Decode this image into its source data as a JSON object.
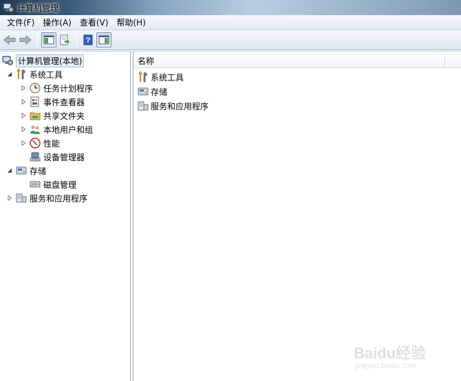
{
  "window": {
    "title": "计算机管理"
  },
  "menubar": {
    "items": [
      {
        "label": "文件(F)"
      },
      {
        "label": "操作(A)"
      },
      {
        "label": "查看(V)"
      },
      {
        "label": "帮助(H)"
      }
    ]
  },
  "toolbar": {
    "buttons": [
      "back-arrow-icon",
      "forward-arrow-icon",
      "show-hide-tree-icon",
      "export-list-icon",
      "help-icon",
      "show-hide-action-pane-icon"
    ]
  },
  "tree": {
    "root": {
      "label": "计算机管理(本地)",
      "icon": "computer-management-icon",
      "selected": true
    },
    "items": [
      {
        "label": "系统工具",
        "icon": "system-tools-icon",
        "expanded": true,
        "level": 1
      },
      {
        "label": "任务计划程序",
        "icon": "task-scheduler-icon",
        "expanded": false,
        "level": 2
      },
      {
        "label": "事件查看器",
        "icon": "event-viewer-icon",
        "expanded": false,
        "level": 2
      },
      {
        "label": "共享文件夹",
        "icon": "shared-folders-icon",
        "expanded": false,
        "level": 2
      },
      {
        "label": "本地用户和组",
        "icon": "local-users-groups-icon",
        "expanded": false,
        "level": 2
      },
      {
        "label": "性能",
        "icon": "performance-icon",
        "expanded": false,
        "level": 2
      },
      {
        "label": "设备管理器",
        "icon": "device-manager-icon",
        "level": 2
      },
      {
        "label": "存储",
        "icon": "storage-icon",
        "expanded": true,
        "level": 1
      },
      {
        "label": "磁盘管理",
        "icon": "disk-management-icon",
        "level": 2
      },
      {
        "label": "服务和应用程序",
        "icon": "services-applications-icon",
        "expanded": false,
        "level": 1
      }
    ]
  },
  "list": {
    "header": {
      "name": "名称"
    },
    "rows": [
      {
        "label": "系统工具",
        "icon": "system-tools-icon"
      },
      {
        "label": "存储",
        "icon": "storage-icon"
      },
      {
        "label": "服务和应用程序",
        "icon": "services-applications-icon"
      }
    ]
  },
  "watermark": {
    "text": "Baidu经验",
    "sub": "jingyan.baidu.com"
  },
  "colors": {
    "titlebar": "#3b5b7c",
    "menubar": "#e3eaf3",
    "toolbar": "#dde6f0",
    "selection": "#e6eef8"
  }
}
